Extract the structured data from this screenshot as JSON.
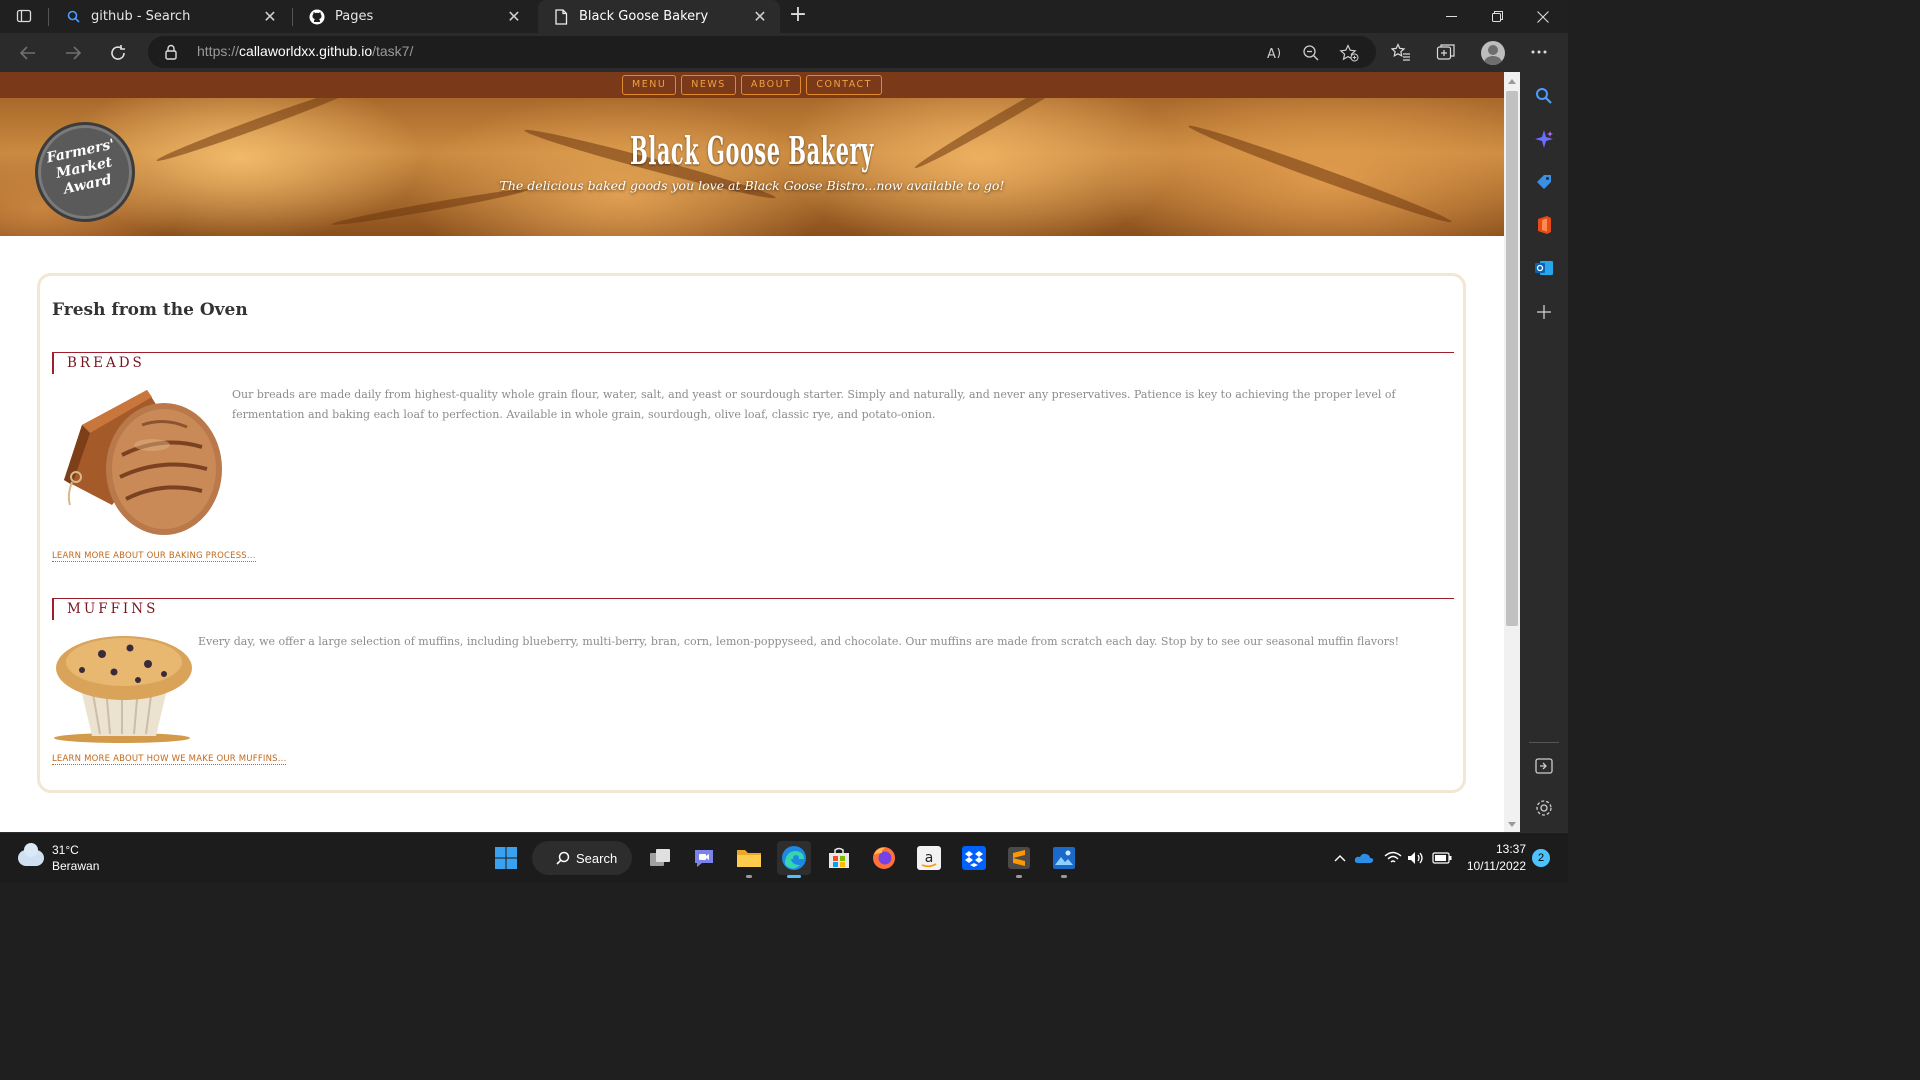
{
  "browser": {
    "tabs": [
      {
        "title": "github - Search",
        "icon": "search-icon"
      },
      {
        "title": "Pages",
        "icon": "github-icon"
      },
      {
        "title": "Black Goose Bakery",
        "icon": "page-icon",
        "active": true
      }
    ],
    "close_glyph": "✕",
    "new_tab_glyph": "+",
    "url_prefix": "https://",
    "url_host": "callaworldxx.github.io",
    "url_path": "/task7/"
  },
  "site": {
    "nav": [
      "MENU",
      "NEWS",
      "ABOUT",
      "CONTACT"
    ],
    "badge_lines": [
      "Farmers'",
      "Market",
      "Award"
    ],
    "title": "Black Goose Bakery",
    "tagline": "The delicious baked goods you love at Black Goose Bistro...now available to go!",
    "card_heading": "Fresh from the Oven",
    "sections": [
      {
        "heading": "BREADS",
        "text": "Our breads are made daily from highest-quality whole grain flour, water, salt, and yeast or sourdough starter. Simply and naturally, and never any preservatives. Patience is key to achieving the proper level of fermentation and baking each loaf to perfection. Available in whole grain, sourdough, olive loaf, classic rye, and potato-onion.",
        "link": "LEARN MORE ABOUT OUR BAKING PROCESS..."
      },
      {
        "heading": "MUFFINS",
        "text": "Every day, we offer a large selection of muffins, including blueberry, multi-berry, bran, corn, lemon-poppyseed, and chocolate. Our muffins are made from scratch each day. Stop by to see our seasonal muffin flavors!",
        "link": "LEARN MORE ABOUT HOW WE MAKE OUR MUFFINS..."
      }
    ]
  },
  "taskbar": {
    "weather_temp": "31°C",
    "weather_desc": "Berawan",
    "search_label": "Search",
    "time": "13:37",
    "date": "10/11/2022",
    "notification_count": "2"
  },
  "colors": {
    "nav_bg": "#7a3a1a",
    "nav_accent": "#e08a2e",
    "section_rule": "#a01d2c",
    "link": "#c0691d"
  }
}
